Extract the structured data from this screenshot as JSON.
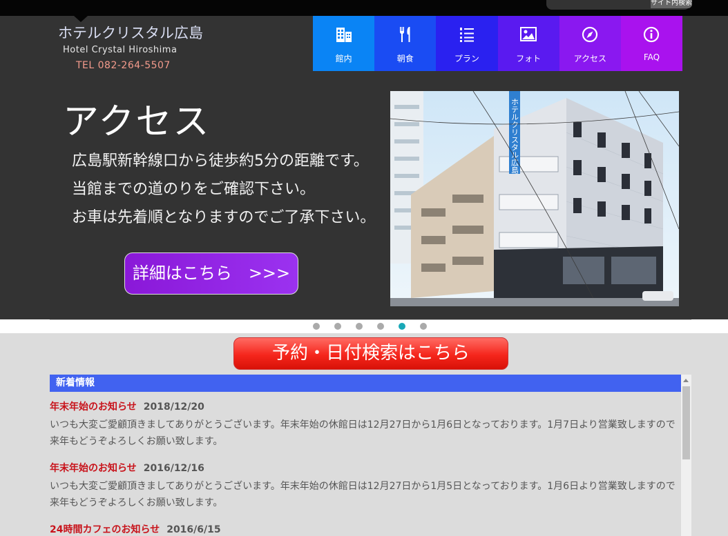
{
  "topbar": {
    "search_label": "サイト内検索"
  },
  "logo": {
    "name_jp": "ホテルクリスタル広島",
    "name_en": "Hotel Crystal Hiroshima",
    "tel": "TEL 082-264-5507"
  },
  "nav": {
    "items": [
      {
        "label": "館内",
        "icon": "building-icon",
        "color": "#0a84f5"
      },
      {
        "label": "朝食",
        "icon": "fork-knife-icon",
        "color": "#1a4cf3"
      },
      {
        "label": "プラン",
        "icon": "list-icon",
        "color": "#2a21f0"
      },
      {
        "label": "フォト",
        "icon": "photo-icon",
        "color": "#5a1af0"
      },
      {
        "label": "アクセス",
        "icon": "compass-icon",
        "color": "#8a18f0"
      },
      {
        "label": "FAQ",
        "icon": "info-icon",
        "color": "#a912ee"
      }
    ]
  },
  "hero": {
    "title": "アクセス",
    "lines": [
      "広島駅新幹線口から徒歩約5分の距離です。",
      "当館までの道のりをご確認下さい。",
      "お車は先着順となりますのでご了承下さい。"
    ],
    "button_label": "詳細はこちら　>>>",
    "photo_sign_text": "ホテルクリスタル広島"
  },
  "slider": {
    "count": 6,
    "active_index": 4
  },
  "reserve_button_label": "予約・日付検索はこちら",
  "news": {
    "header": "新着情報",
    "items": [
      {
        "title": "年末年始のお知らせ",
        "date": "2018/12/20",
        "body": "いつも大変ご愛顧頂きましてありがとうございます。年末年始の休館日は12月27日から1月6日となっております。1月7日より営業致しますので来年もどうぞよろしくお願い致します。"
      },
      {
        "title": "年末年始のお知らせ",
        "date": "2016/12/16",
        "body": "いつも大変ご愛顧頂きましてありがとうございます。年末年始の休館日は12月27日から1月5日となっております。1月6日より営業致しますので来年もどうぞよろしくお願い致します。"
      },
      {
        "title": "24時間カフェのお知らせ",
        "date": "2016/6/15",
        "body": ""
      }
    ]
  },
  "colors": {
    "header_bg": "#333333",
    "news_header": "#4162f0",
    "news_title": "#c8131b",
    "reserve_button": "#f5261c",
    "detail_button": "#9b32f0",
    "dot_active": "#19a8b7"
  }
}
